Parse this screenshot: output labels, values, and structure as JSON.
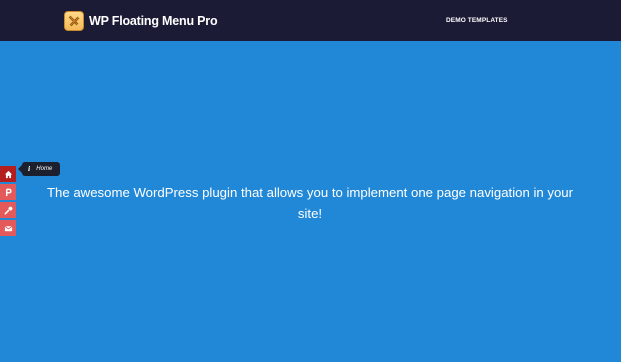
{
  "header": {
    "brand_name": "WP Floating Menu Pro",
    "logo_icon": "crossed-swords-logo-icon",
    "nav": [
      {
        "label": "DEMO TEMPLATES"
      }
    ]
  },
  "hero": {
    "text": "The awesome WordPress plugin that allows you to implement one page navigation in your site!"
  },
  "floating_menu": {
    "items": [
      {
        "icon": "home-icon",
        "active": true
      },
      {
        "icon": "p-icon",
        "active": false
      },
      {
        "icon": "wrench-icon",
        "active": false
      },
      {
        "icon": "envelope-icon",
        "active": false
      }
    ],
    "tooltip": {
      "icon": "info-icon",
      "label": "Home"
    }
  },
  "colors": {
    "header_bg": "#1b1b36",
    "page_bg": "#2188d8",
    "menu_active": "#b51e1e",
    "menu_item": "#e45a5a",
    "tooltip_bg": "#1c1f2e"
  }
}
